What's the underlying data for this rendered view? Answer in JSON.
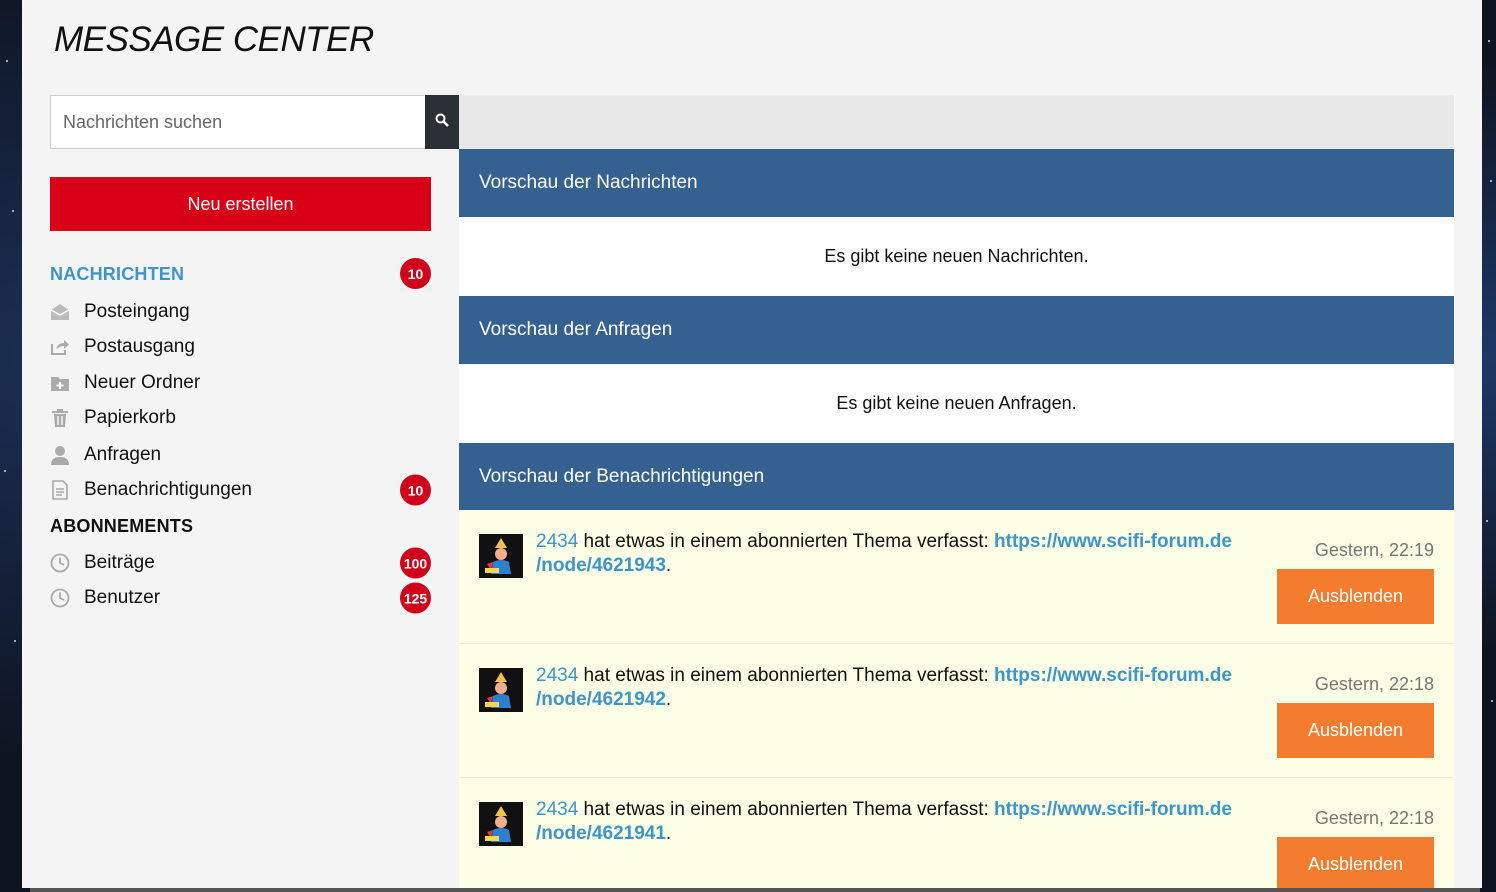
{
  "page": {
    "title": "MESSAGE CENTER"
  },
  "search": {
    "placeholder": "Nachrichten suchen",
    "icon": "search-icon"
  },
  "actions": {
    "new_label": "Neu erstellen"
  },
  "sidebar": {
    "messages_heading": "NACHRICHTEN",
    "messages_badge": "10",
    "items": [
      {
        "label": "Posteingang",
        "icon": "inbox-icon"
      },
      {
        "label": "Postausgang",
        "icon": "outbox-icon"
      },
      {
        "label": "Neuer Ordner",
        "icon": "new-folder-icon"
      },
      {
        "label": "Papierkorb",
        "icon": "trash-icon"
      },
      {
        "label": "Anfragen",
        "icon": "user-icon"
      },
      {
        "label": "Benachrichtigungen",
        "icon": "document-icon",
        "badge": "10"
      }
    ],
    "subscriptions_heading": "ABONNEMENTS",
    "subscriptions": [
      {
        "label": "Beiträge",
        "icon": "clock-icon",
        "badge": "100"
      },
      {
        "label": "Benutzer",
        "icon": "clock-icon",
        "badge": "125"
      }
    ]
  },
  "sections": {
    "messages": {
      "title": "Vorschau der Nachrichten",
      "empty": "Es gibt keine neuen Nachrichten."
    },
    "requests": {
      "title": "Vorschau der Anfragen",
      "empty": "Es gibt keine neuen Anfragen."
    },
    "notifications": {
      "title": "Vorschau der Benachrichtigungen"
    }
  },
  "notifications": [
    {
      "user": "2434",
      "text": " hat etwas in einem abonnierten Thema verfasst: ",
      "url_line1": "https://www.scifi-forum.de",
      "url_line2": "/node/4621943",
      "period": ".",
      "time": "Gestern, 22:19",
      "button": "Ausblenden"
    },
    {
      "user": "2434",
      "text": " hat etwas in einem abonnierten Thema verfasst: ",
      "url_line1": "https://www.scifi-forum.de",
      "url_line2": "/node/4621942",
      "period": ".",
      "time": "Gestern, 22:18",
      "button": "Ausblenden"
    },
    {
      "user": "2434",
      "text": " hat etwas in einem abonnierten Thema verfasst: ",
      "url_line1": "https://www.scifi-forum.de",
      "url_line2": "/node/4621941",
      "period": ".",
      "time": "Gestern, 22:18",
      "button": "Ausblenden"
    }
  ],
  "colors": {
    "brand_red": "#d70016",
    "header_blue": "#34618f",
    "link_blue": "#3d95c8",
    "button_orange": "#f47c2f",
    "notification_bg": "#fdfee6"
  }
}
